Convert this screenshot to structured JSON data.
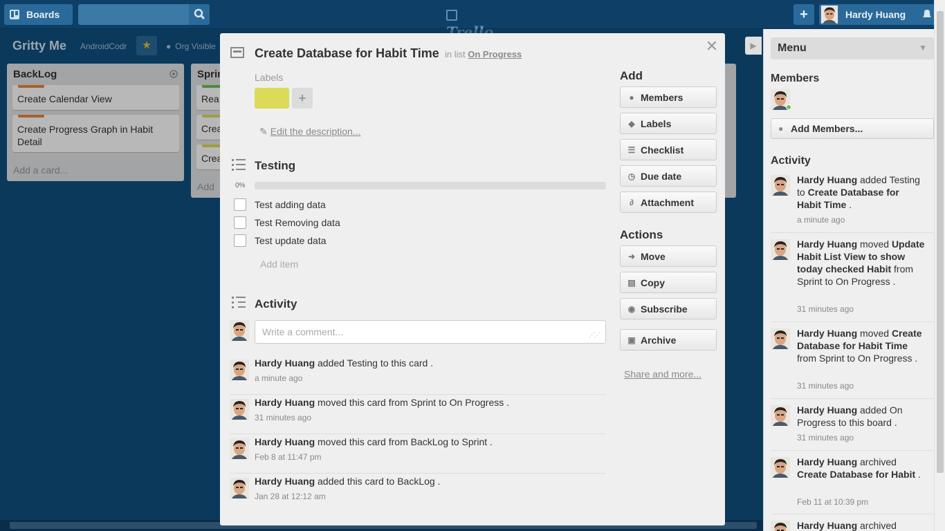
{
  "header": {
    "boards_label": "Boards",
    "search_placeholder": "",
    "logo_text": "Trello",
    "user_name": "Hardy Huang"
  },
  "board": {
    "title": "Gritty Me",
    "org": "AndroidCodr",
    "visibility": "Org Visible"
  },
  "lists": [
    {
      "title": "BackLog",
      "cards": [
        {
          "text": "Create Calendar View",
          "label_color": "#e48a3c"
        },
        {
          "text": "Create Progress Graph in Habit Detail",
          "label_color": "#e48a3c"
        }
      ],
      "add_card": "Add a card..."
    },
    {
      "title": "Sprint",
      "cards": [
        {
          "text": "Rea",
          "label_color": "#6fbf4b"
        },
        {
          "text": "Crea",
          "label_color": "#dbdb57"
        },
        {
          "text": "Crea",
          "label_color": "#dbdb57"
        }
      ],
      "add_card": "Add"
    }
  ],
  "card_detail": {
    "title": "Create Database for Habit Time",
    "in_list_prefix": "in list",
    "list_name": "On Progress",
    "labels_heading": "Labels",
    "label_color": "#dbdb57",
    "edit_description": "Edit the description...",
    "checklist": {
      "title": "Testing",
      "percent": "0%",
      "progress": 0,
      "items": [
        {
          "text": "Test adding data",
          "checked": false
        },
        {
          "text": "Test Removing data",
          "checked": false
        },
        {
          "text": "Test update data",
          "checked": false
        }
      ],
      "add_item": "Add item"
    },
    "activity": {
      "title": "Activity",
      "comment_placeholder": "Write a comment...",
      "items": [
        {
          "user": "Hardy Huang",
          "text": "added Testing to this card .",
          "time": "a minute ago"
        },
        {
          "user": "Hardy Huang",
          "text": "moved this card from Sprint to On Progress .",
          "time": "31 minutes ago"
        },
        {
          "user": "Hardy Huang",
          "text": "moved this card from BackLog to Sprint .",
          "time": "Feb 8 at 11:47 pm"
        },
        {
          "user": "Hardy Huang",
          "text": "added this card to BackLog .",
          "time": "Jan 28 at 12:12 am"
        }
      ]
    },
    "sidebar": {
      "add_heading": "Add",
      "add_buttons": [
        {
          "label": "Members",
          "icon": "person-icon"
        },
        {
          "label": "Labels",
          "icon": "tag-icon"
        },
        {
          "label": "Checklist",
          "icon": "checklist-icon"
        },
        {
          "label": "Due date",
          "icon": "clock-icon"
        },
        {
          "label": "Attachment",
          "icon": "paperclip-icon"
        }
      ],
      "actions_heading": "Actions",
      "action_buttons": [
        {
          "label": "Move",
          "icon": "arrow-right-icon"
        },
        {
          "label": "Copy",
          "icon": "copy-icon"
        },
        {
          "label": "Subscribe",
          "icon": "eye-icon"
        },
        {
          "label": "Archive",
          "icon": "archive-icon"
        }
      ],
      "share_more": "Share and more..."
    }
  },
  "menu": {
    "title": "Menu",
    "members_heading": "Members",
    "add_members": "Add Members...",
    "activity_heading": "Activity",
    "activity": [
      {
        "user": "Hardy Huang",
        "pre": "added Testing to ",
        "bold": "Create Database for Habit Time",
        "post": " .",
        "time": "a minute ago"
      },
      {
        "user": "Hardy Huang",
        "pre": "moved ",
        "bold": "Update Habit List View to show today checked Habit",
        "post": " from Sprint to On Progress .",
        "time": "31 minutes ago"
      },
      {
        "user": "Hardy Huang",
        "pre": "moved ",
        "bold": "Create Database for Habit Time",
        "post": " from Sprint to On Progress .",
        "time": "31 minutes ago"
      },
      {
        "user": "Hardy Huang",
        "pre": "added On Progress to this board .",
        "bold": "",
        "post": "",
        "time": "31 minutes ago"
      },
      {
        "user": "Hardy Huang",
        "pre": "archived ",
        "bold": "Create Database for Habit",
        "post": " .",
        "time": "Feb 11 at 10:39 pm"
      },
      {
        "user": "Hardy Huang",
        "pre": "archived",
        "bold": "",
        "post": "",
        "time": ""
      }
    ]
  },
  "colors": {
    "board_bg": "#0f4f80",
    "header_bg": "#0d3f67",
    "label_yellow": "#dbdb57",
    "label_orange": "#e48a3c",
    "label_green": "#6fbf4b"
  }
}
